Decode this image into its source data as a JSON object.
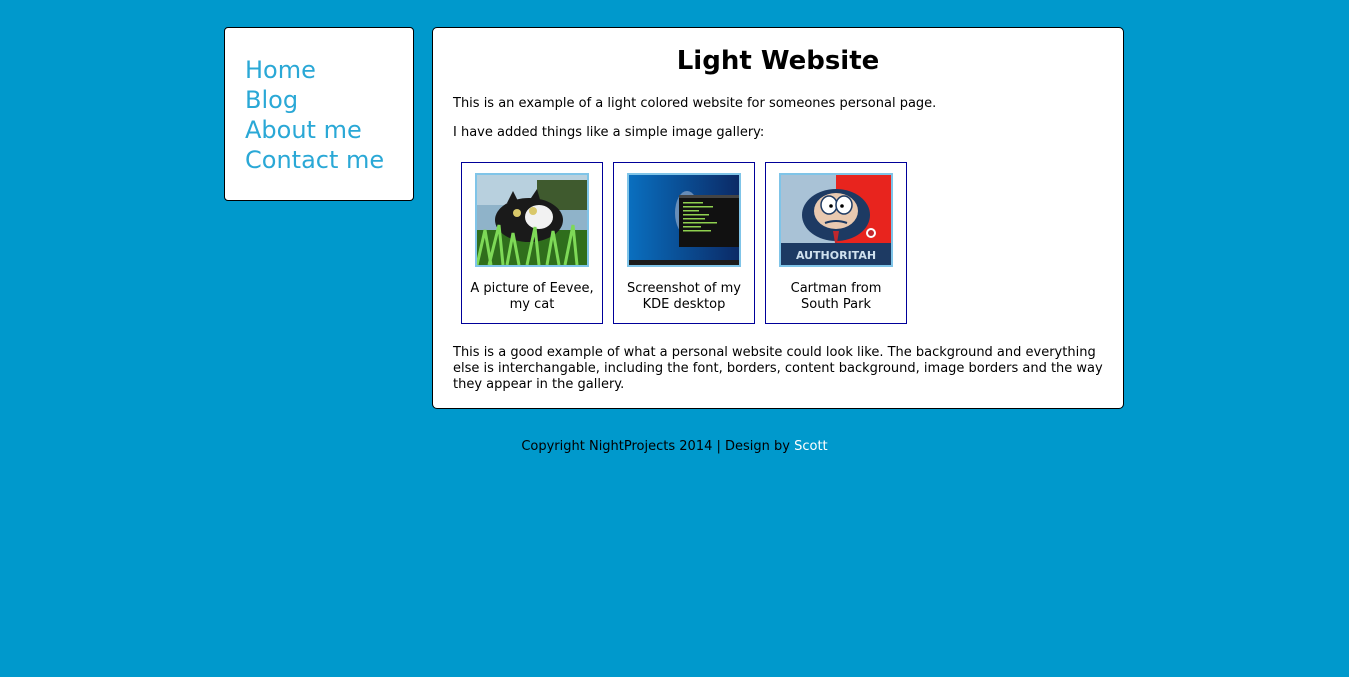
{
  "nav": {
    "items": [
      {
        "label": "Home"
      },
      {
        "label": "Blog"
      },
      {
        "label": "About me"
      },
      {
        "label": "Contact me"
      }
    ]
  },
  "main": {
    "title": "Light Website",
    "intro": "This is an example of a light colored website for someones personal page.",
    "gallery_intro": "I have added things like a simple image gallery:",
    "gallery": [
      {
        "caption": "A picture of Eevee, my cat",
        "image": "cat-photo"
      },
      {
        "caption": "Screenshot of my KDE desktop",
        "image": "kde-desktop-screenshot"
      },
      {
        "caption": "Cartman from South Park",
        "image": "cartman-authoritah-poster",
        "image_text": "AUTHORITAH"
      }
    ],
    "outro": "This is a good example of what a personal website could look like. The background and everything else is interchangable, including the font, borders, content background, image borders and the way they appear in the gallery."
  },
  "footer": {
    "text": "Copyright NightProjects 2014 | Design by",
    "link_label": "Scott"
  },
  "colors": {
    "background": "#0099cc",
    "nav_link": "#2aa8d6",
    "gallery_border": "#000099",
    "thumb_border": "#7fc4e8",
    "footer_link": "#ffffff"
  }
}
